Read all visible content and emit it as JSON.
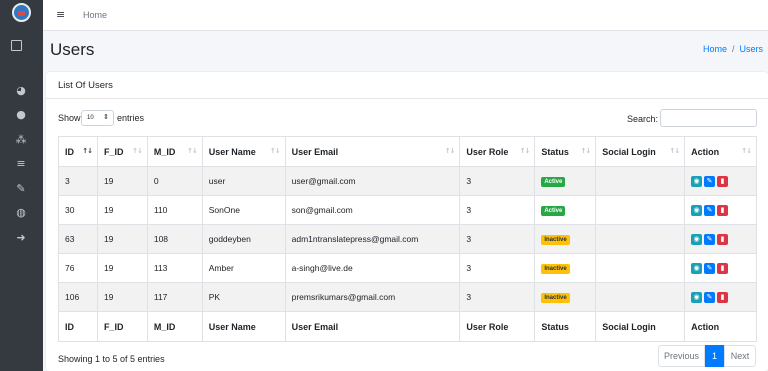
{
  "topbar": {
    "home": "Home"
  },
  "page": {
    "title": "Users"
  },
  "breadcrumb": {
    "home": "Home",
    "sep": "/",
    "current": "Users"
  },
  "card": {
    "title": "List Of Users"
  },
  "length": {
    "show": "Show",
    "value": "10",
    "entries": "entries"
  },
  "search": {
    "label": "Search:",
    "value": ""
  },
  "table": {
    "headers": [
      "ID",
      "F_ID",
      "M_ID",
      "User Name",
      "User Email",
      "User Role",
      "Status",
      "Social Login",
      "Action"
    ],
    "rows": [
      {
        "id": "3",
        "fid": "19",
        "mid": "0",
        "name": "user",
        "email": "user@gmail.com",
        "role": "3",
        "status": "Active",
        "social": ""
      },
      {
        "id": "30",
        "fid": "19",
        "mid": "110",
        "name": "SonOne",
        "email": "son@gmail.com",
        "role": "3",
        "status": "Active",
        "social": ""
      },
      {
        "id": "63",
        "fid": "19",
        "mid": "108",
        "name": "goddeyben",
        "email": "adm1ntranslatepress@gmail.com",
        "role": "3",
        "status": "Inactive",
        "social": ""
      },
      {
        "id": "76",
        "fid": "19",
        "mid": "113",
        "name": "Amber",
        "email": "a-singh@live.de",
        "role": "3",
        "status": "Inactive",
        "social": ""
      },
      {
        "id": "106",
        "fid": "19",
        "mid": "117",
        "name": "PK",
        "email": "premsrikumars@gmail.com",
        "role": "3",
        "status": "Inactive",
        "social": ""
      }
    ]
  },
  "info": "Showing 1 to 5 of 5 entries",
  "pagination": {
    "previous": "Previous",
    "current": "1",
    "next": "Next"
  },
  "colors": {
    "sidebar": "#343a40",
    "primary": "#007bff",
    "active": "#28a745",
    "inactive": "#ffc107",
    "view": "#17a2b8",
    "delete": "#dc3545"
  }
}
